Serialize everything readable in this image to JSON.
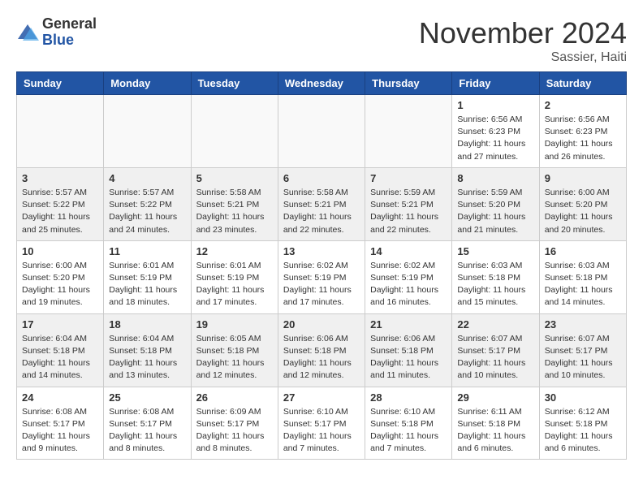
{
  "header": {
    "logo_line1": "General",
    "logo_line2": "Blue",
    "month_title": "November 2024",
    "location": "Sassier, Haiti"
  },
  "weekdays": [
    "Sunday",
    "Monday",
    "Tuesday",
    "Wednesday",
    "Thursday",
    "Friday",
    "Saturday"
  ],
  "weeks": [
    [
      {
        "day": "",
        "info": ""
      },
      {
        "day": "",
        "info": ""
      },
      {
        "day": "",
        "info": ""
      },
      {
        "day": "",
        "info": ""
      },
      {
        "day": "",
        "info": ""
      },
      {
        "day": "1",
        "info": "Sunrise: 6:56 AM\nSunset: 6:23 PM\nDaylight: 11 hours\nand 27 minutes."
      },
      {
        "day": "2",
        "info": "Sunrise: 6:56 AM\nSunset: 6:23 PM\nDaylight: 11 hours\nand 26 minutes."
      }
    ],
    [
      {
        "day": "3",
        "info": "Sunrise: 5:57 AM\nSunset: 5:22 PM\nDaylight: 11 hours\nand 25 minutes."
      },
      {
        "day": "4",
        "info": "Sunrise: 5:57 AM\nSunset: 5:22 PM\nDaylight: 11 hours\nand 24 minutes."
      },
      {
        "day": "5",
        "info": "Sunrise: 5:58 AM\nSunset: 5:21 PM\nDaylight: 11 hours\nand 23 minutes."
      },
      {
        "day": "6",
        "info": "Sunrise: 5:58 AM\nSunset: 5:21 PM\nDaylight: 11 hours\nand 22 minutes."
      },
      {
        "day": "7",
        "info": "Sunrise: 5:59 AM\nSunset: 5:21 PM\nDaylight: 11 hours\nand 22 minutes."
      },
      {
        "day": "8",
        "info": "Sunrise: 5:59 AM\nSunset: 5:20 PM\nDaylight: 11 hours\nand 21 minutes."
      },
      {
        "day": "9",
        "info": "Sunrise: 6:00 AM\nSunset: 5:20 PM\nDaylight: 11 hours\nand 20 minutes."
      }
    ],
    [
      {
        "day": "10",
        "info": "Sunrise: 6:00 AM\nSunset: 5:20 PM\nDaylight: 11 hours\nand 19 minutes."
      },
      {
        "day": "11",
        "info": "Sunrise: 6:01 AM\nSunset: 5:19 PM\nDaylight: 11 hours\nand 18 minutes."
      },
      {
        "day": "12",
        "info": "Sunrise: 6:01 AM\nSunset: 5:19 PM\nDaylight: 11 hours\nand 17 minutes."
      },
      {
        "day": "13",
        "info": "Sunrise: 6:02 AM\nSunset: 5:19 PM\nDaylight: 11 hours\nand 17 minutes."
      },
      {
        "day": "14",
        "info": "Sunrise: 6:02 AM\nSunset: 5:19 PM\nDaylight: 11 hours\nand 16 minutes."
      },
      {
        "day": "15",
        "info": "Sunrise: 6:03 AM\nSunset: 5:18 PM\nDaylight: 11 hours\nand 15 minutes."
      },
      {
        "day": "16",
        "info": "Sunrise: 6:03 AM\nSunset: 5:18 PM\nDaylight: 11 hours\nand 14 minutes."
      }
    ],
    [
      {
        "day": "17",
        "info": "Sunrise: 6:04 AM\nSunset: 5:18 PM\nDaylight: 11 hours\nand 14 minutes."
      },
      {
        "day": "18",
        "info": "Sunrise: 6:04 AM\nSunset: 5:18 PM\nDaylight: 11 hours\nand 13 minutes."
      },
      {
        "day": "19",
        "info": "Sunrise: 6:05 AM\nSunset: 5:18 PM\nDaylight: 11 hours\nand 12 minutes."
      },
      {
        "day": "20",
        "info": "Sunrise: 6:06 AM\nSunset: 5:18 PM\nDaylight: 11 hours\nand 12 minutes."
      },
      {
        "day": "21",
        "info": "Sunrise: 6:06 AM\nSunset: 5:18 PM\nDaylight: 11 hours\nand 11 minutes."
      },
      {
        "day": "22",
        "info": "Sunrise: 6:07 AM\nSunset: 5:17 PM\nDaylight: 11 hours\nand 10 minutes."
      },
      {
        "day": "23",
        "info": "Sunrise: 6:07 AM\nSunset: 5:17 PM\nDaylight: 11 hours\nand 10 minutes."
      }
    ],
    [
      {
        "day": "24",
        "info": "Sunrise: 6:08 AM\nSunset: 5:17 PM\nDaylight: 11 hours\nand 9 minutes."
      },
      {
        "day": "25",
        "info": "Sunrise: 6:08 AM\nSunset: 5:17 PM\nDaylight: 11 hours\nand 8 minutes."
      },
      {
        "day": "26",
        "info": "Sunrise: 6:09 AM\nSunset: 5:17 PM\nDaylight: 11 hours\nand 8 minutes."
      },
      {
        "day": "27",
        "info": "Sunrise: 6:10 AM\nSunset: 5:17 PM\nDaylight: 11 hours\nand 7 minutes."
      },
      {
        "day": "28",
        "info": "Sunrise: 6:10 AM\nSunset: 5:18 PM\nDaylight: 11 hours\nand 7 minutes."
      },
      {
        "day": "29",
        "info": "Sunrise: 6:11 AM\nSunset: 5:18 PM\nDaylight: 11 hours\nand 6 minutes."
      },
      {
        "day": "30",
        "info": "Sunrise: 6:12 AM\nSunset: 5:18 PM\nDaylight: 11 hours\nand 6 minutes."
      }
    ]
  ]
}
